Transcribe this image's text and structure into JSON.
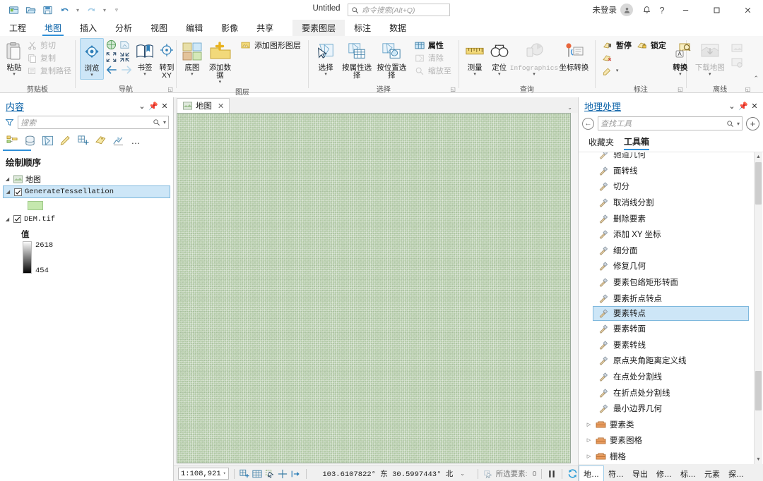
{
  "titlebar": {
    "document_title": "Untitled",
    "command_search_placeholder": "命令搜索(Alt+Q)",
    "sign_in_label": "未登录",
    "quick_access": [
      "new-project-icon",
      "open-project-icon",
      "save-project-icon",
      "undo-icon",
      "redo-icon",
      "customize-qat-icon"
    ],
    "window_buttons": {
      "minimize": "—",
      "maximize": "☐",
      "close": "✕"
    },
    "help_label": "?"
  },
  "ribbon_tabs": {
    "main": [
      "工程",
      "地图",
      "插入",
      "分析",
      "视图",
      "编辑",
      "影像",
      "共享"
    ],
    "active": "地图",
    "contextual": [
      "要素图层",
      "标注",
      "数据"
    ],
    "contextual_active": "要素图层"
  },
  "ribbon_groups": [
    {
      "label": "剪贴板",
      "big": [
        {
          "label": "粘贴",
          "icon": "paste-icon",
          "dropdown": true
        }
      ],
      "small": [
        {
          "label": "剪切",
          "icon": "cut-icon",
          "disabled": true
        },
        {
          "label": "复制",
          "icon": "copy-icon",
          "disabled": true
        },
        {
          "label": "复制路径",
          "icon": "copy-path-icon",
          "disabled": true
        }
      ]
    },
    {
      "label": "导航",
      "has_launcher": true,
      "big": [
        {
          "label": "浏览",
          "icon": "explore-navigate-icon",
          "selected": true,
          "dropdown": true
        },
        {
          "label": "书签",
          "icon": "bookmarks-icon",
          "dropdown": true
        },
        {
          "label": "转到 XY",
          "icon": "go-to-xy-icon",
          "dropdown": false
        }
      ],
      "small_icons": [
        "full-extent-icon",
        "previous-extent-icon",
        "fixed-zoom-in-icon",
        "fixed-zoom-out-icon",
        "back-arrow-icon",
        "forward-arrow-icon"
      ]
    },
    {
      "label": "图层",
      "big": [
        {
          "label": "底图",
          "icon": "basemap-icon",
          "dropdown": true
        },
        {
          "label": "添加数据",
          "icon": "add-data-icon",
          "dropdown": true
        }
      ],
      "small": [
        {
          "label": "添加图形图层",
          "icon": "add-graphics-layer-icon",
          "disabled": false
        }
      ]
    },
    {
      "label": "选择",
      "has_launcher": true,
      "big": [
        {
          "label": "选择",
          "icon": "select-icon",
          "dropdown": true
        },
        {
          "label": "按属性选择",
          "icon": "select-by-attribute-icon"
        },
        {
          "label": "按位置选择",
          "icon": "select-by-location-icon"
        }
      ],
      "small": [
        {
          "label": "属性",
          "icon": "attributes-icon",
          "disabled": false
        },
        {
          "label": "清除",
          "icon": "clear-selection-icon",
          "disabled": true
        },
        {
          "label": "缩放至",
          "icon": "zoom-to-selection-icon",
          "disabled": true
        }
      ]
    },
    {
      "label": "查询",
      "big": [
        {
          "label": "测量",
          "icon": "measure-icon",
          "dropdown": true
        },
        {
          "label": "定位",
          "icon": "locate-icon",
          "dropdown": true
        },
        {
          "label": "Infographics",
          "icon": "infographics-icon",
          "dropdown": true,
          "disabled": true
        },
        {
          "label": "坐标转换",
          "icon": "coordinate-conversion-icon"
        }
      ]
    },
    {
      "label": "标注",
      "has_launcher": true,
      "big": [
        {
          "label": "转换",
          "icon": "convert-labels-icon",
          "dropdown": true
        }
      ],
      "small": [
        {
          "label": "暂停",
          "icon": "pause-labeling-icon"
        },
        {
          "label": "锁定",
          "icon": "lock-labels-icon"
        },
        {
          "label": "",
          "icon": "remove-labels-icon"
        },
        {
          "label": "",
          "icon": "label-style-icon"
        }
      ]
    },
    {
      "label": "离线",
      "has_launcher": true,
      "big": [
        {
          "label": "下载地图",
          "icon": "download-map-icon",
          "dropdown": true,
          "disabled": true
        }
      ],
      "small_icons": [
        "sync-replica-icon",
        "manage-replica-icon"
      ]
    }
  ],
  "contents_pane": {
    "title": "内容",
    "search_placeholder": "搜索",
    "toolbar_icons": [
      "list-by-drawing-order-icon",
      "list-by-data-source-icon",
      "list-by-selection-icon",
      "list-by-editing-icon",
      "list-by-snapping-icon",
      "list-by-labeling-icon",
      "list-by-charts-icon",
      "more-options-icon"
    ],
    "header_buttons": [
      "chevron-down-icon",
      "pin-icon",
      "close-icon"
    ],
    "section_title": "绘制顺序",
    "tree": {
      "map_name": "地图",
      "layers": [
        {
          "name": "GenerateTessellation",
          "checked": true,
          "selected": true,
          "symbol": {
            "type": "polygon",
            "fill": "#c5e8ae",
            "outline": "#9fc98a"
          }
        },
        {
          "name": "DEM.tif",
          "checked": true,
          "selected": false,
          "legend_title": "值",
          "ramp_max": "2618",
          "ramp_min": "454"
        }
      ]
    }
  },
  "map_view": {
    "tab_label": "地图",
    "tab_icon": "map-icon",
    "close_label": "✕",
    "layer_fill_color": "#b6cdaa"
  },
  "status_bar": {
    "scale": "1:108,921",
    "coordinates": "103.6107822° 东  30.5997443° 北",
    "selected_features_label": "所选要素:",
    "selected_features_count": "0",
    "icons": [
      "add-grid-icon",
      "table-icon",
      "selection-tools-icon",
      "crosshair-icon",
      "next-extent-icon",
      "pause-drawing-icon",
      "refresh-icon"
    ]
  },
  "geoprocessing_pane": {
    "title": "地理处理",
    "header_buttons": [
      "chevron-down-icon",
      "pin-icon",
      "close-icon"
    ],
    "back_icon": "back-arrow-icon",
    "search_placeholder": "查找工具",
    "add_icon": "add-toolbox-icon",
    "tabs": [
      "收藏夹",
      "工具箱"
    ],
    "active_tab": "工具箱",
    "tools": [
      {
        "name": "驰道几何",
        "type": "tool",
        "partial": true
      },
      {
        "name": "面转线",
        "type": "tool"
      },
      {
        "name": "切分",
        "type": "tool"
      },
      {
        "name": "取消线分割",
        "type": "tool"
      },
      {
        "name": "删除要素",
        "type": "tool"
      },
      {
        "name": "添加 XY 坐标",
        "type": "tool"
      },
      {
        "name": "细分面",
        "type": "tool"
      },
      {
        "name": "修复几何",
        "type": "tool"
      },
      {
        "name": "要素包络矩形转面",
        "type": "tool"
      },
      {
        "name": "要素折点转点",
        "type": "tool"
      },
      {
        "name": "要素转点",
        "type": "tool",
        "selected": true
      },
      {
        "name": "要素转面",
        "type": "tool"
      },
      {
        "name": "要素转线",
        "type": "tool"
      },
      {
        "name": "原点夹角距离定义线",
        "type": "tool"
      },
      {
        "name": "在点处分割线",
        "type": "tool"
      },
      {
        "name": "在折点处分割线",
        "type": "tool"
      },
      {
        "name": "最小边界几何",
        "type": "tool"
      },
      {
        "name": "要素类",
        "type": "toolbox"
      },
      {
        "name": "要素图格",
        "type": "toolbox"
      },
      {
        "name": "栅格",
        "type": "toolbox"
      }
    ],
    "bottom_tabs": [
      "地…",
      "符…",
      "导出",
      "修…",
      "标…",
      "元素",
      "探…"
    ],
    "bottom_active": "地…"
  }
}
